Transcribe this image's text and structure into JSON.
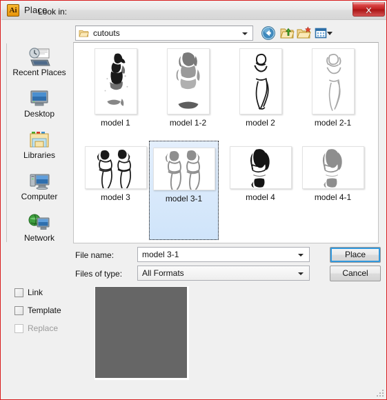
{
  "window": {
    "title": "Place",
    "app_icon": "Ai",
    "close_label": "✕"
  },
  "toolbar": {
    "lookin_label": "Look in:",
    "lookin_value": "cutouts",
    "icons": [
      {
        "name": "back-icon",
        "tooltip": "Back"
      },
      {
        "name": "up-one-level-icon",
        "tooltip": "Up One Level"
      },
      {
        "name": "new-folder-icon",
        "tooltip": "Create New Folder"
      },
      {
        "name": "views-icon",
        "tooltip": "Views"
      }
    ]
  },
  "sidebar": {
    "items": [
      {
        "label": "Recent Places",
        "icon": "recent-places-icon"
      },
      {
        "label": "Desktop",
        "icon": "desktop-icon"
      },
      {
        "label": "Libraries",
        "icon": "libraries-icon"
      },
      {
        "label": "Computer",
        "icon": "computer-icon"
      },
      {
        "label": "Network",
        "icon": "network-icon"
      }
    ]
  },
  "filelist": {
    "items": [
      {
        "label": "model 1",
        "orientation": "portrait",
        "selected": false
      },
      {
        "label": "model 1-2",
        "orientation": "portrait",
        "selected": false
      },
      {
        "label": "model 2",
        "orientation": "portrait",
        "selected": false
      },
      {
        "label": "model 2-1",
        "orientation": "portrait",
        "selected": false
      },
      {
        "label": "model 3",
        "orientation": "landscape",
        "selected": false
      },
      {
        "label": "model 3-1",
        "orientation": "landscape",
        "selected": true
      },
      {
        "label": "model 4",
        "orientation": "landscape",
        "selected": false
      },
      {
        "label": "model 4-1",
        "orientation": "landscape",
        "selected": false
      }
    ]
  },
  "form": {
    "filename_label": "File name:",
    "filename_value": "model 3-1",
    "filetype_label": "Files of type:",
    "filetype_value": "All Formats",
    "place_button": "Place",
    "cancel_button": "Cancel"
  },
  "options": {
    "checkboxes": [
      {
        "label": "Link",
        "checked": false,
        "disabled": false
      },
      {
        "label": "Template",
        "checked": false,
        "disabled": false
      },
      {
        "label": "Replace",
        "checked": false,
        "disabled": true
      }
    ]
  },
  "preview": {
    "fill_color": "#666666"
  },
  "colors": {
    "window_border": "#d81c1c",
    "dialog_bg": "#f0f0f0",
    "selection_blue": "#cfe4fa",
    "focus_blue": "#3399dd"
  }
}
